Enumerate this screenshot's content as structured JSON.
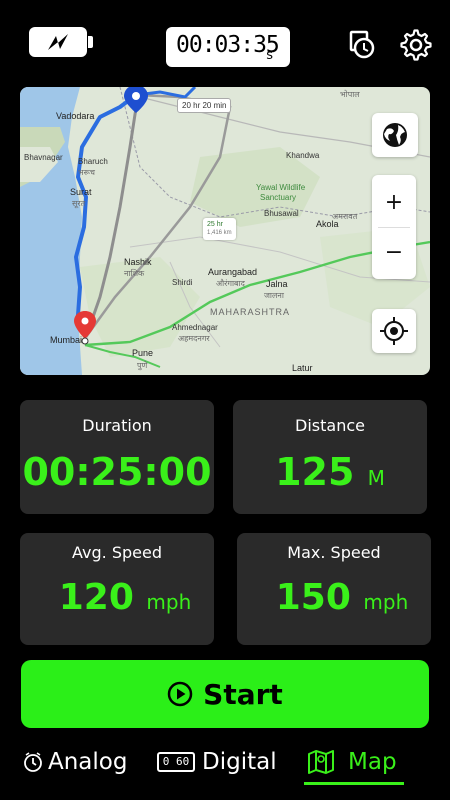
{
  "header": {
    "battery_icon": "battery-charging-icon",
    "timer_value": "00:03:35",
    "timer_unit": "s",
    "reset_icon": "history-reset-icon",
    "settings_icon": "gear-icon"
  },
  "map": {
    "route_tag": "20 hr 20 min",
    "duration_tag_time": "25 hr",
    "duration_tag_dist": "1,416 km",
    "labels": {
      "vadodara": "Vadodara",
      "bhavnagar": "Bhavnagar",
      "bharuch": "Bharuch",
      "surat": "Surat",
      "nashik": "Nashik",
      "mumbai": "Mumbai",
      "pune": "Pune",
      "pune_local": "पुणे",
      "aurangabad": "Aurangabad",
      "aurangabad_local": "औरंगाबाद",
      "maharashtra": "MAHARASHTRA",
      "ahmednagar": "Ahmednagar",
      "ahmednagar_local": "अहमदनगर",
      "khandwa": "Khandwa",
      "yawal": "Yawal Wildlife",
      "yawal2": "Sanctuary",
      "bhusawal": "Bhusawal",
      "akola": "Akola",
      "amravati": "अमरावत",
      "jalna": "Jalna",
      "jalna_local": "जालना",
      "latur": "Latur",
      "bhopal": "भोपाल",
      "shirdi": "Shirdi",
      "nashik_local": "नाशिक",
      "surat_local": "सूरत",
      "bharuch_local": "भरूच"
    },
    "globe_icon": "globe-icon",
    "zoom_in": "+",
    "zoom_out": "−",
    "locate_icon": "crosshair-locate-icon"
  },
  "stats": {
    "duration": {
      "title": "Duration",
      "value": "00:25:00"
    },
    "distance": {
      "title": "Distance",
      "value": "125",
      "unit": "M"
    },
    "avg_speed": {
      "title": "Avg. Speed",
      "value": "120",
      "unit": "mph"
    },
    "max_speed": {
      "title": "Max. Speed",
      "value": "150",
      "unit": "mph"
    }
  },
  "start_button": {
    "label": "Start",
    "icon": "play-circle-icon"
  },
  "nav": {
    "analog": "Analog",
    "digital": "Digital",
    "digital_badge": "0 60",
    "map": "Map"
  },
  "colors": {
    "accent": "#3af01a",
    "card": "#2a2a2a",
    "background": "#000000"
  }
}
